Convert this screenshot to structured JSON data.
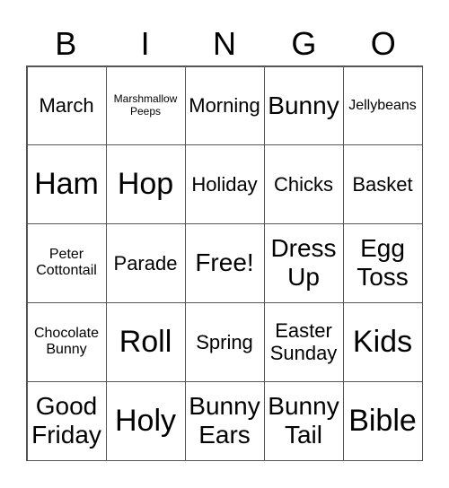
{
  "header": {
    "letters": [
      "B",
      "I",
      "N",
      "G",
      "O"
    ]
  },
  "board": {
    "cells": [
      {
        "text": "March",
        "size": "md"
      },
      {
        "text": "Marshmallow Peeps",
        "size": "xs"
      },
      {
        "text": "Morning",
        "size": "md"
      },
      {
        "text": "Bunny",
        "size": "lg"
      },
      {
        "text": "Jellybeans",
        "size": "sm"
      },
      {
        "text": "Ham",
        "size": "xl"
      },
      {
        "text": "Hop",
        "size": "xl"
      },
      {
        "text": "Holiday",
        "size": "md"
      },
      {
        "text": "Chicks",
        "size": "md"
      },
      {
        "text": "Basket",
        "size": "md"
      },
      {
        "text": "Peter Cottontail",
        "size": "sm"
      },
      {
        "text": "Parade",
        "size": "md"
      },
      {
        "text": "Free!",
        "size": "lg"
      },
      {
        "text": "Dress Up",
        "size": "lg"
      },
      {
        "text": "Egg Toss",
        "size": "lg"
      },
      {
        "text": "Chocolate Bunny",
        "size": "sm"
      },
      {
        "text": "Roll",
        "size": "xl"
      },
      {
        "text": "Spring",
        "size": "md"
      },
      {
        "text": "Easter Sunday",
        "size": "md"
      },
      {
        "text": "Kids",
        "size": "xl"
      },
      {
        "text": "Good Friday",
        "size": "lg"
      },
      {
        "text": "Holy",
        "size": "xl"
      },
      {
        "text": "Bunny Ears",
        "size": "lg"
      },
      {
        "text": "Bunny Tail",
        "size": "lg"
      },
      {
        "text": "Bible",
        "size": "xl"
      }
    ]
  }
}
